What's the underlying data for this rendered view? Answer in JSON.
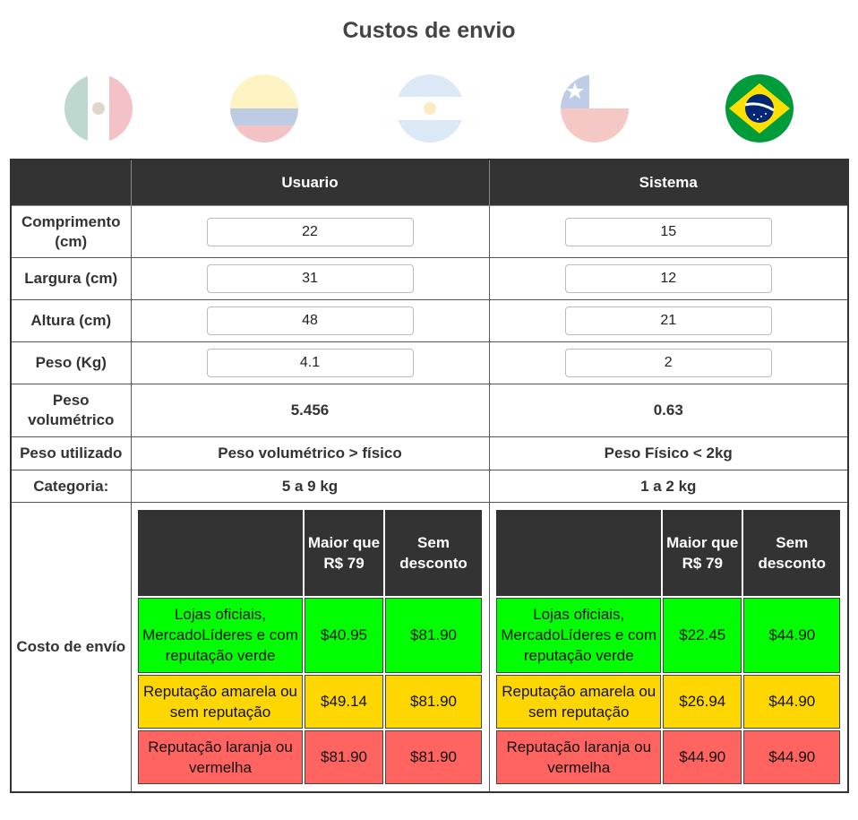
{
  "title": "Custos de envio",
  "flags": [
    {
      "name": "mexico-flag-icon",
      "active": false
    },
    {
      "name": "colombia-flag-icon",
      "active": false
    },
    {
      "name": "argentina-flag-icon",
      "active": false
    },
    {
      "name": "chile-flag-icon",
      "active": false
    },
    {
      "name": "brazil-flag-icon",
      "active": true
    }
  ],
  "headers": {
    "empty": "",
    "usuario": "Usuario",
    "sistema": "Sistema"
  },
  "rows": {
    "comprimento": {
      "label": "Comprimento (cm)",
      "usuario": "22",
      "sistema": "15"
    },
    "largura": {
      "label": "Largura (cm)",
      "usuario": "31",
      "sistema": "12"
    },
    "altura": {
      "label": "Altura (cm)",
      "usuario": "48",
      "sistema": "21"
    },
    "peso": {
      "label": "Peso (Kg)",
      "usuario": "4.1",
      "sistema": "2"
    },
    "peso_volumetrico": {
      "label": "Peso volumétrico",
      "usuario": "5.456",
      "sistema": "0.63"
    },
    "peso_utilizado": {
      "label": "Peso utilizado",
      "usuario": "Peso volumétrico > físico",
      "sistema": "Peso Físico < 2kg"
    },
    "categoria": {
      "label": "Categoria:",
      "usuario": "5 a 9 kg",
      "sistema": "1 a 2 kg"
    },
    "costo": {
      "label": "Costo de envío"
    }
  },
  "shipping": {
    "headers": {
      "empty": "",
      "maior": "Maior que R$ 79",
      "sem": "Sem desconto"
    },
    "tiers": [
      "Lojas oficiais, MercadoLíderes e com reputação verde",
      "Reputação amarela ou sem reputação",
      "Reputação laranja ou vermelha"
    ],
    "usuario": [
      {
        "maior": "$40.95",
        "sem": "$81.90"
      },
      {
        "maior": "$49.14",
        "sem": "$81.90"
      },
      {
        "maior": "$81.90",
        "sem": "$81.90"
      }
    ],
    "sistema": [
      {
        "maior": "$22.45",
        "sem": "$44.90"
      },
      {
        "maior": "$26.94",
        "sem": "$44.90"
      },
      {
        "maior": "$44.90",
        "sem": "$44.90"
      }
    ]
  },
  "colors": {
    "green": "#00ff00",
    "yellow": "#ffd700",
    "red": "#ff6461",
    "header": "#333333"
  }
}
